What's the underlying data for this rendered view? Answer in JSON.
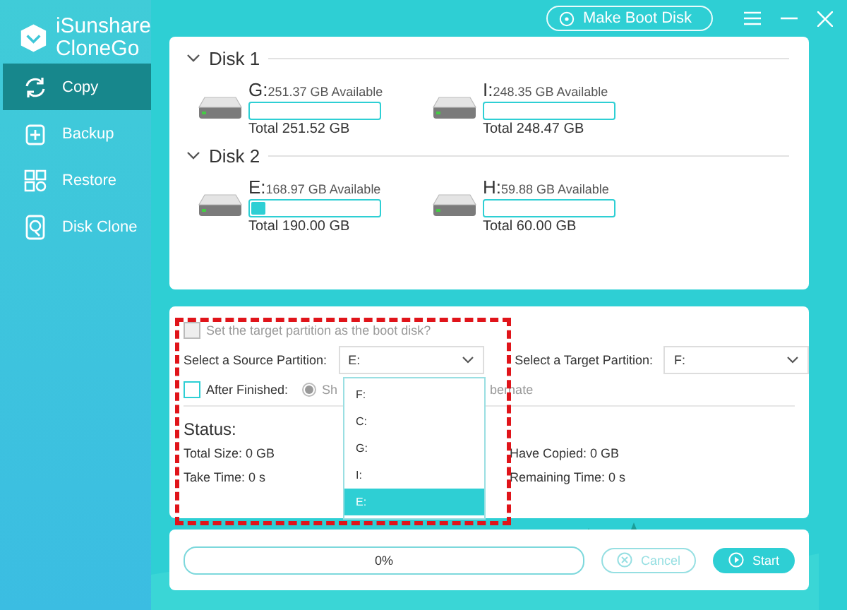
{
  "app": {
    "name_line_1": "iSunshare",
    "name_line_2": "CloneGo"
  },
  "sidebar": {
    "items": [
      {
        "label": "Copy",
        "selected": true,
        "kind": "copy"
      },
      {
        "label": "Backup",
        "selected": false,
        "kind": "backup"
      },
      {
        "label": "Restore",
        "selected": false,
        "kind": "restore"
      },
      {
        "label": "Disk Clone",
        "selected": false,
        "kind": "clone"
      }
    ]
  },
  "toolbar": {
    "make_boot_disk": "Make Boot Disk"
  },
  "disks": [
    {
      "name": "Disk 1",
      "expanded": true,
      "partitions": [
        {
          "letter": "G:",
          "available": "251.37 GB Available",
          "level": 0,
          "total": "Total 251.52 GB"
        },
        {
          "letter": "I:",
          "available": "248.35 GB Available",
          "level": 0,
          "total": "Total 248.47 GB"
        }
      ]
    },
    {
      "name": "Disk 2",
      "expanded": true,
      "partitions": [
        {
          "letter": "E:",
          "available": "168.97 GB Available",
          "level": 0.11,
          "total": "Total 190.00 GB"
        },
        {
          "letter": "H:",
          "available": "59.88 GB Available",
          "level": 0,
          "total": "Total 60.00 GB"
        }
      ]
    }
  ],
  "options": {
    "boot_checkbox": {
      "label": "Set the target partition as the boot disk?",
      "checked": false,
      "disabled": true
    },
    "source": {
      "label": "Select a Source Partition:",
      "value": "E:",
      "dropdown": {
        "items": [
          {
            "label": "F:",
            "selected": false
          },
          {
            "label": "C:",
            "selected": false
          },
          {
            "label": "G:",
            "selected": false
          },
          {
            "label": "I:",
            "selected": false
          },
          {
            "label": "E:",
            "selected": true
          }
        ]
      }
    },
    "target": {
      "label": "Select a Target Partition:",
      "value": "F:"
    },
    "after_finished": {
      "label": "After Finished:",
      "checked": false,
      "radio": {
        "selected": true,
        "label_start": "Sh",
        "label_end": "bernate"
      }
    },
    "status": {
      "title": "Status:",
      "fields": [
        "Total Size: 0 GB",
        "Have Copied: 0 GB",
        "Take Time: 0 s",
        "Remaining Time: 0 s"
      ]
    }
  },
  "progress": {
    "level": 0,
    "label": "0%"
  },
  "buttons": [
    {
      "label": "Cancel",
      "kind": "cancel",
      "disabled": true
    },
    {
      "label": "Start",
      "kind": "start",
      "disabled": false
    }
  ]
}
